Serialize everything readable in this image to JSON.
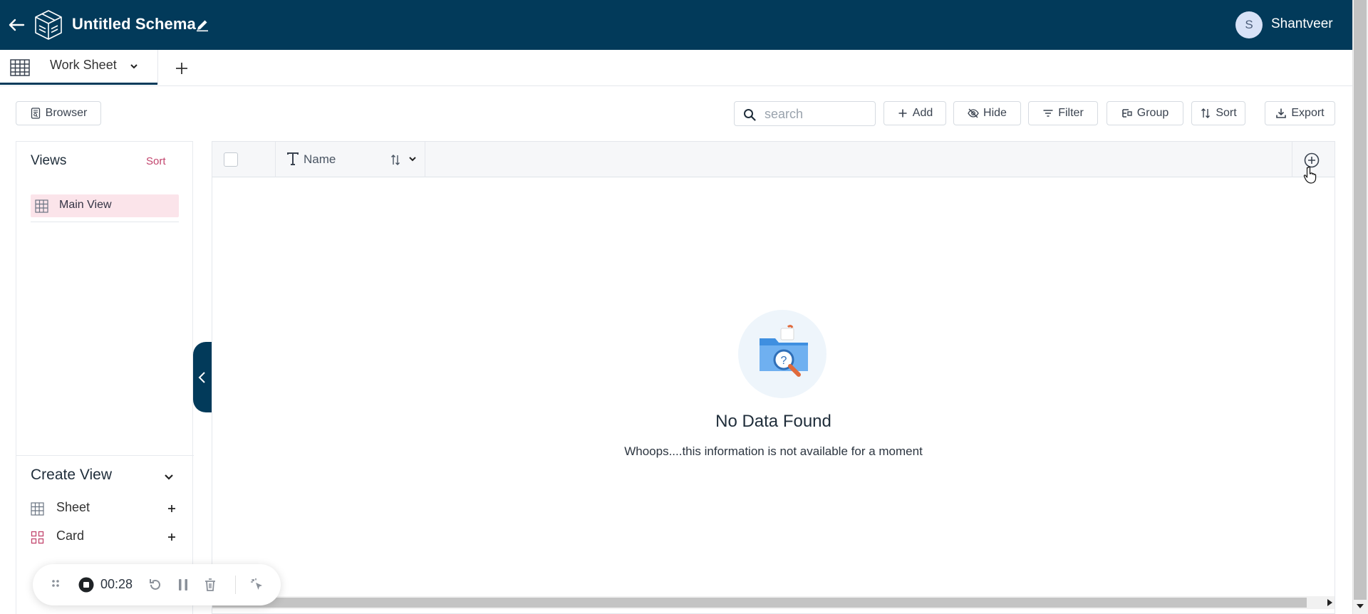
{
  "header": {
    "title": "Untitled Schema",
    "user_initial": "S",
    "user_name": "Shantveer"
  },
  "tabs": {
    "active_label": "Work Sheet"
  },
  "toolbar": {
    "browser_label": "Browser",
    "search_placeholder": "search",
    "add_label": "Add",
    "hide_label": "Hide",
    "filter_label": "Filter",
    "group_label": "Group",
    "sort_label": "Sort",
    "export_label": "Export"
  },
  "sidebar": {
    "views_title": "Views",
    "sort_label": "Sort",
    "views": [
      {
        "label": "Main View",
        "icon": "grid-icon"
      }
    ],
    "create_view_title": "Create View",
    "create_items": [
      {
        "label": "Sheet",
        "icon": "grid-icon"
      },
      {
        "label": "Card",
        "icon": "card-grid-icon"
      }
    ]
  },
  "grid": {
    "columns": [
      {
        "label": "Name",
        "type_icon": "text-type-icon"
      }
    ],
    "empty_title": "No Data Found",
    "empty_message": "Whoops....this information is not available for a moment"
  },
  "recorder": {
    "elapsed": "00:28"
  },
  "colors": {
    "header_bg": "#023a5a",
    "accent_pink": "#c2456d",
    "selected_view_bg": "#fbe4ea"
  }
}
